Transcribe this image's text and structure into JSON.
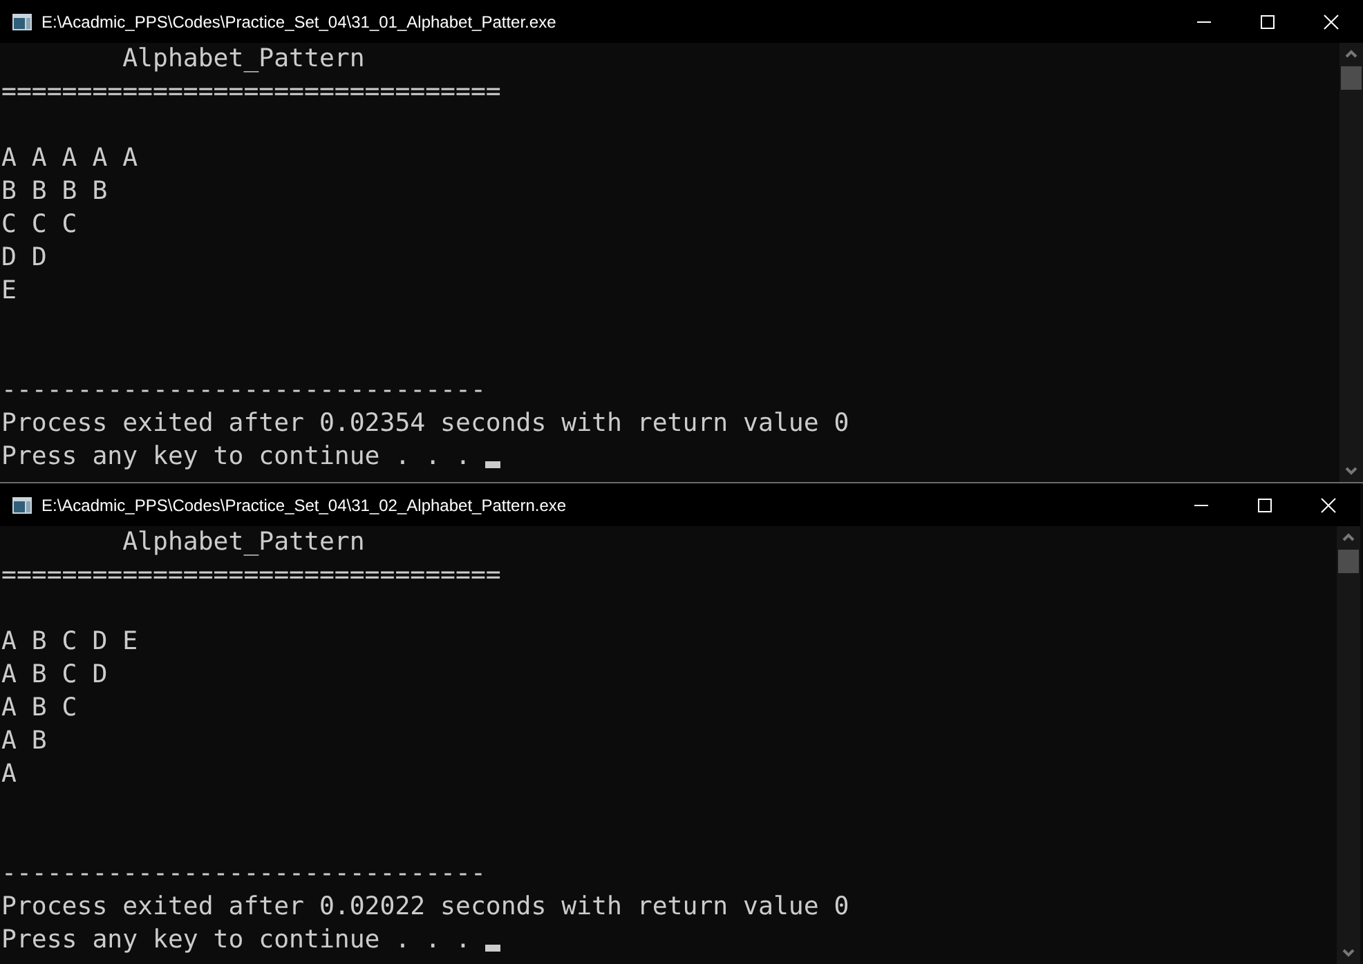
{
  "windows": [
    {
      "title": "E:\\Acadmic_PPS\\Codes\\Practice_Set_04\\31_01_Alphabet_Patter.exe",
      "lines": [
        {
          "kind": "heading",
          "text": "Alphabet_Pattern"
        },
        {
          "kind": "text",
          "text": "================================="
        },
        {
          "kind": "blank"
        },
        {
          "kind": "text",
          "text": "A A A A A"
        },
        {
          "kind": "text",
          "text": "B B B B"
        },
        {
          "kind": "text",
          "text": "C C C"
        },
        {
          "kind": "text",
          "text": "D D"
        },
        {
          "kind": "text",
          "text": "E"
        },
        {
          "kind": "blank"
        },
        {
          "kind": "blank"
        },
        {
          "kind": "text",
          "text": "--------------------------------"
        },
        {
          "kind": "text",
          "text": "Process exited after 0.02354 seconds with return value 0"
        },
        {
          "kind": "prompt",
          "text": "Press any key to continue . . ."
        }
      ]
    },
    {
      "title": "E:\\Acadmic_PPS\\Codes\\Practice_Set_04\\31_02_Alphabet_Pattern.exe",
      "lines": [
        {
          "kind": "heading",
          "text": "Alphabet_Pattern"
        },
        {
          "kind": "text",
          "text": "================================="
        },
        {
          "kind": "blank"
        },
        {
          "kind": "text",
          "text": "A B C D E"
        },
        {
          "kind": "text",
          "text": "A B C D"
        },
        {
          "kind": "text",
          "text": "A B C"
        },
        {
          "kind": "text",
          "text": "A B"
        },
        {
          "kind": "text",
          "text": "A"
        },
        {
          "kind": "blank"
        },
        {
          "kind": "blank"
        },
        {
          "kind": "text",
          "text": "--------------------------------"
        },
        {
          "kind": "text",
          "text": "Process exited after 0.02022 seconds with return value 0"
        },
        {
          "kind": "prompt",
          "text": "Press any key to continue . . ."
        }
      ]
    }
  ]
}
